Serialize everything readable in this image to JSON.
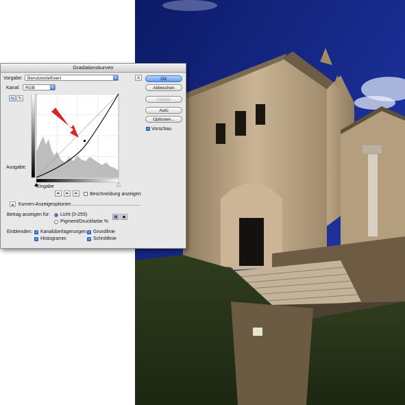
{
  "dialog": {
    "title": "Gradationskurven",
    "preset_label": "Vorgabe:",
    "preset_value": "Benutzerdefiniert",
    "channel_label": "Kanal:",
    "channel_value": "RGB",
    "output_label": "Ausgabe:",
    "input_label": "Eingabe",
    "show_clipping_label": "Beschneidung anzeigen",
    "curve_options_label": "Kurven-Anzeigeoptionen",
    "amount_label": "Betrag anzeigen für:",
    "light_option": "Licht (0-255)",
    "pigment_option": "Pigment/Druckfarbe %",
    "show_label": "Einblenden:",
    "overlay_channel": "Kanalüberlagerungen",
    "overlay_baseline": "Grundlinie",
    "overlay_histogram": "Histogramm",
    "overlay_intersection": "Schnittlinie",
    "buttons": {
      "ok": "OK",
      "cancel": "Abbrechen",
      "smooth": "Glätten",
      "auto": "Auto",
      "options": "Optionen..."
    },
    "preview_label": "Vorschau",
    "states": {
      "show_clipping": false,
      "light_selected": true,
      "pigment_selected": false,
      "overlay_channel": true,
      "overlay_baseline": true,
      "overlay_histogram": true,
      "overlay_intersection": true,
      "preview": true
    }
  },
  "colors": {
    "sky": "#13227a",
    "arrow": "#d8252a",
    "button_blue": "#5a9aee"
  },
  "icons": {
    "curve_tool": "curve-point-icon",
    "pencil_tool": "pencil-icon",
    "black_eyedropper": "eyedropper-black-icon",
    "gray_eyedropper": "eyedropper-gray-icon",
    "white_eyedropper": "eyedropper-white-icon",
    "expand": "disclosure-triangle-icon"
  }
}
